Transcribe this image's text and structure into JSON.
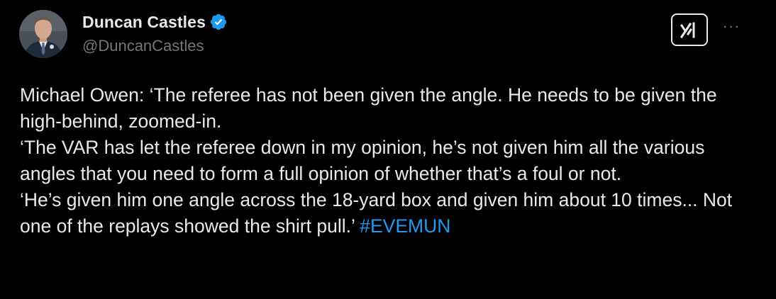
{
  "author": {
    "display_name": "Duncan Castles",
    "handle": "@DuncanCastles",
    "verified": true,
    "verified_color": "#1d9bf0"
  },
  "actions": {
    "grok_icon": "grok-icon",
    "more_icon": "more-icon",
    "more_label": "···"
  },
  "tweet": {
    "paragraphs": [
      "Michael Owen: ‘The referee has not been given the angle. He needs to be given the high-behind, zoomed-in.",
      "‘The VAR has let the referee down in my opinion, he’s not given him all the various angles that you need to form a full opinion of whether that’s a foul or not.",
      "‘He’s given him one angle across the 18-yard box and given him about 10 times... Not one of the replays showed the shirt pull.’"
    ],
    "hashtag": "#EVEMUN",
    "hashtag_color": "#1d9bf0"
  },
  "colors": {
    "background": "#000000",
    "text_primary": "#e7e9ea",
    "text_secondary": "#71767b"
  }
}
